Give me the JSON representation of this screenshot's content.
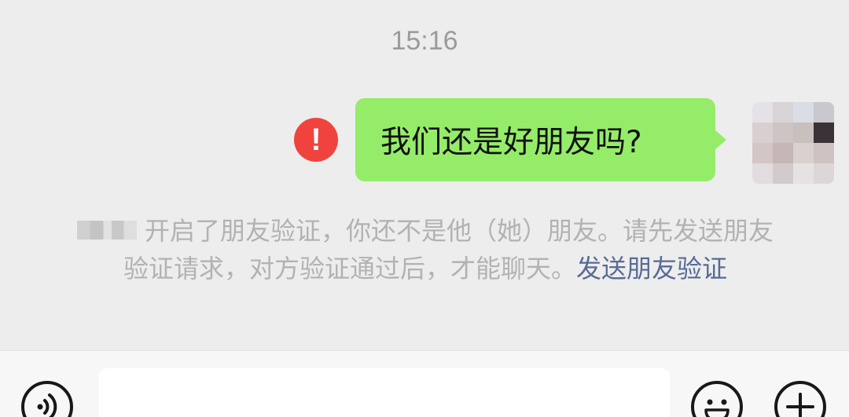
{
  "chat": {
    "timestamp": "15:16",
    "outgoing_message": {
      "text": "我们还是好朋友吗?",
      "status_icon": "error-icon",
      "status_symbol": "!"
    },
    "system_note": {
      "masked_name_icon": "pixelated-name",
      "text": "开启了朋友验证，你还不是他（她）朋友。请先发送朋友验证请求，对方验证通过后，才能聊天。",
      "link_label": "发送朋友验证"
    }
  },
  "input_bar": {
    "voice_icon": "voice-icon",
    "text_value": "",
    "emoji_icon": "emoji-icon",
    "plus_icon": "plus-icon"
  },
  "colors": {
    "background": "#ededed",
    "bubble_green": "#95ec69",
    "error_red": "#f1433e",
    "link_blue": "#576b95",
    "system_text": "#b2b2b2"
  }
}
